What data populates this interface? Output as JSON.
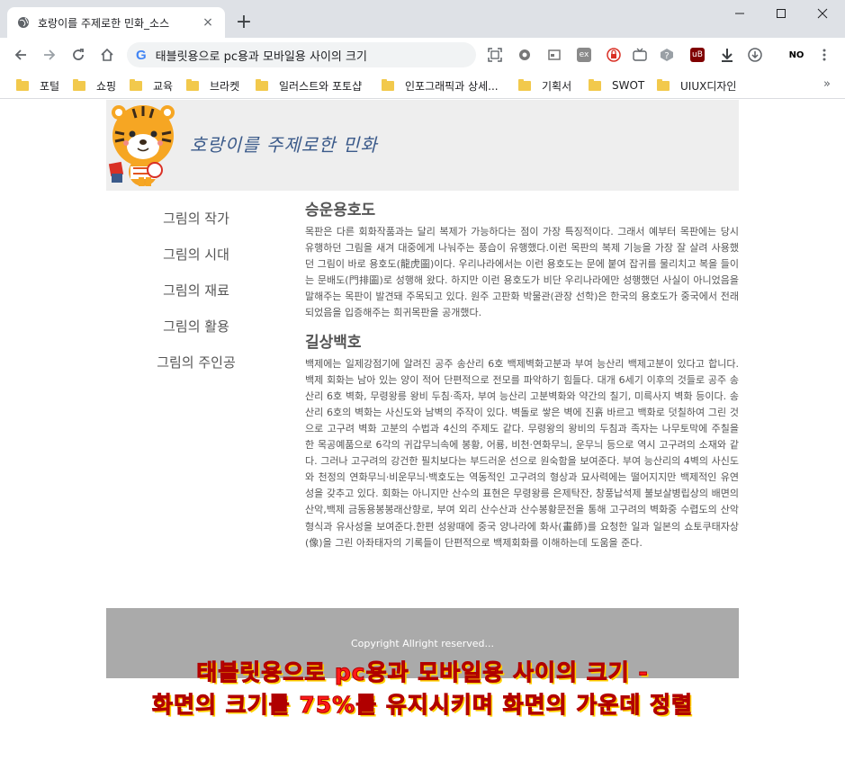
{
  "browser": {
    "tab_title": "호랑이를 주제로한 민화_소스",
    "new_tab_symbol": "+",
    "close_symbol": "×",
    "url": "태블릿용으로 pc용과 모바일용 사이의 크기",
    "search_engine_glyph": "G",
    "bookmarks": [
      "포털",
      "쇼핑",
      "교육",
      "브라켓",
      "일러스트와 포토샵",
      "인포그래픽과 상세...",
      "기획서",
      "SWOT",
      "UIUX디자인"
    ],
    "bookmarks_more": "»",
    "ext_labels": {
      "nh": "NO",
      "ub": "uB",
      "ex": "ex"
    }
  },
  "page": {
    "site_title": "호랑이를 주제로한 민화",
    "nav": [
      "그림의 작가",
      "그림의 시대",
      "그림의 재료",
      "그림의 활용",
      "그림의 주인공"
    ],
    "sections": [
      {
        "title": "승운용호도",
        "body": "목판은 다른 회화작품과는 달리 복제가 가능하다는 점이 가장 특징적이다. 그래서 예부터 목판에는 당시 유행하던 그림을 새겨 대중에게 나눠주는 풍습이 유행했다.이런 목판의 복제 기능을 가장 잘 살려 사용했던 그림이 바로 용호도(龍虎圖)이다. 우리나라에서는 이런 용호도는 문에 붙여 잡귀를 물리치고 복을 들이는 문배도(門排圖)로 성행해 왔다. 하지만 이런 용호도가 비단 우리나라에만 성행했던 사실이 아니었음을 말해주는 목판이 발견돼 주목되고 있다. 원주 고판화 박물관(관장 선학)은 한국의 용호도가 중국에서 전래되었음을 입증해주는 희귀목판을 공개했다."
      },
      {
        "title": "길상백호",
        "body": "백제에는 일제강점기에 알려진 공주 송산리 6호 백제벽화고분과 부여 능산리 백제고분이 있다고 합니다. 백제 회화는 남아 있는 양이 적어 단편적으로 전모를 파악하기 힘들다. 대개 6세기 이후의 것들로 공주 송산리 6호 벽화, 무령왕릉 왕비 두침·족자, 부여 능산리 고분벽화와 약간의 칠기, 미륵사지 벽화 등이다. 송산리 6호의 벽화는 사신도와 남벽의 주작이 있다. 벽돌로 쌓은 벽에 진흙 바르고 백화로 덧칠하여 그린 것으로 고구려 벽화 고분의 수법과 4신의 주제도 같다. 무령왕의 왕비의 두침과 족자는 나무토막에 주칠을 한 목공예품으로 6각의 귀갑무늬속에 봉황, 어룡, 비천·연화무늬, 운무늬 등으로 역시 고구려의 소재와 같다. 그러나 고구려의 강건한 필치보다는 부드러운 선으로 원숙함을 보여준다. 부여 능산리의 4벽의 사신도와 천정의 연화무늬·비운무늬·백호도는 역동적인 고구려의 형상과 묘사력에는 떨어지지만 백제적인 유연성을 갖추고 있다. 회화는 아니지만 산수의 표현은 무령왕릉 은제탁잔, 창풍납석제 불보살병립상의 배면의 산악,백제 금동용봉봉래산향로, 부여 외리 산수산과 산수봉황문전을 통해 고구려의 벽화중 수렵도의 산악형식과 유사성을 보여준다.한편 성왕때에 중국 양나라에 화사(畫師)를 요청한 일과 일본의 쇼토쿠태자상(像)을 그린 아좌태자의 기록들이 단편적으로 백제회화를 이해하는데 도움을 준다."
      }
    ],
    "footer": "Copyright Allright reserved..."
  },
  "overlay": {
    "line1": "태블릿용으로 pc용과 모바일용 사이의 크기 -",
    "line2": "화면의 크기를 75%를 유지시키며 화면의 가운데 정렬"
  },
  "colors": {
    "header_bg": "#eeeeee",
    "footer_bg": "#aaaaaa",
    "text": "#555555",
    "overlay_text": "#ff1a1a"
  }
}
